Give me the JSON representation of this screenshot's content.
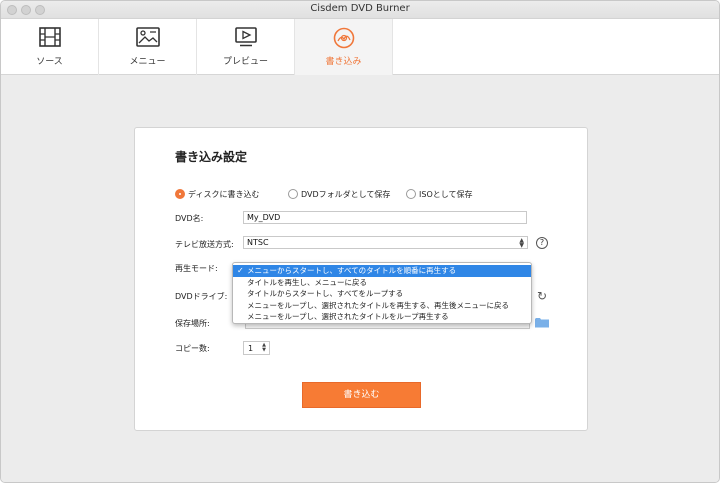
{
  "window": {
    "title": "Cisdem DVD Burner"
  },
  "tabs": [
    {
      "label": "ソース",
      "icon": "film-icon"
    },
    {
      "label": "メニュー",
      "icon": "menu-image-icon"
    },
    {
      "label": "プレビュー",
      "icon": "play-icon"
    },
    {
      "label": "書き込み",
      "icon": "burn-disc-icon",
      "active": true
    }
  ],
  "panel": {
    "title": "書き込み設定",
    "output_options": [
      {
        "label": "ディスクに書き込む",
        "checked": true
      },
      {
        "label": "DVDフォルダとして保存",
        "checked": false
      },
      {
        "label": "ISOとして保存",
        "checked": false
      }
    ],
    "dvd_name_label": "DVD名:",
    "dvd_name_value": "My_DVD",
    "tv_standard_label": "テレビ放送方式:",
    "tv_standard_value": "NTSC",
    "help_glyph": "?",
    "playback_mode_label": "再生モード:",
    "dvd_drive_label": "DVDドライブ:",
    "save_location_label": "保存場所:",
    "copies_label": "コピー数:",
    "copies_value": "1",
    "burn_button": "書き込む"
  },
  "playback_dropdown": {
    "options": [
      "メニューからスタートし、すべてのタイトルを順番に再生する",
      "タイトルを再生し、メニューに戻る",
      "タイトルからスタートし、すべてをループする",
      "メニューをループし、選択されたタイトルを再生する、再生後メニューに戻る",
      "メニューをループし、選択されたタイトルをループ再生する"
    ],
    "selected_index": 0,
    "check_glyph": "✓"
  },
  "colors": {
    "accent": "#f77b34",
    "selection": "#2f86e6"
  }
}
